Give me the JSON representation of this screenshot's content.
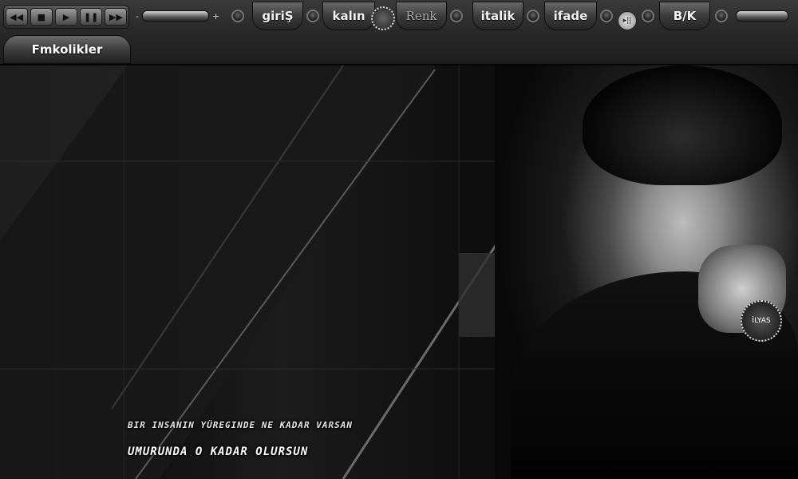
{
  "toolbar": {
    "media_icons": {
      "prev": "skip-back-icon",
      "stop": "stop-icon",
      "play": "play-icon",
      "pause": "pause-icon",
      "next": "skip-forward-icon"
    },
    "volume_left": {
      "minus": "-",
      "plus": "+"
    },
    "tabs": {
      "giris": "giriŞ",
      "kalin": "kalın",
      "renk": "Renk",
      "italik": "italik",
      "ifade": "ifade",
      "bk": "B/K"
    },
    "badge_icon": "emblem-icon",
    "play_circle": "▸||"
  },
  "station": {
    "label": "Fmkolikler"
  },
  "caption": {
    "line1": "BIR INSANIN YÜREGINDE NE KADAR VARSAN",
    "line2": "UMURUNDA O KADAR OLURSUN"
  },
  "seal": {
    "text": "İLYAS"
  },
  "colors": {
    "toolbar": "#2a2a2a",
    "stage": "#0e0e0e",
    "text": "#ffffff"
  }
}
